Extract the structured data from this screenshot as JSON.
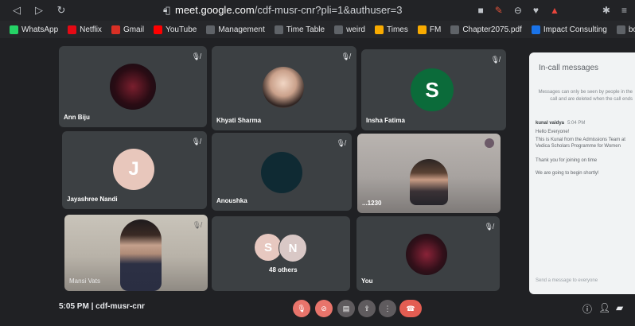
{
  "browser": {
    "url_domain": "meet.google.com",
    "url_path": "/cdf-musr-cnr?pli=1&authuser=3",
    "bookmarks": [
      {
        "label": "WhatsApp",
        "icon": "whatsapp-icon",
        "color": "#25d366"
      },
      {
        "label": "Netflix",
        "icon": "netflix-icon",
        "color": "#e50914"
      },
      {
        "label": "Gmail",
        "icon": "gmail-icon",
        "color": "#d93025"
      },
      {
        "label": "YouTube",
        "icon": "youtube-icon",
        "color": "#ff0000"
      },
      {
        "label": "Management",
        "icon": "globe-icon",
        "color": "#5f6368"
      },
      {
        "label": "Time Table",
        "icon": "globe-icon",
        "color": "#5f6368"
      },
      {
        "label": "weird",
        "icon": "globe-icon",
        "color": "#5f6368"
      },
      {
        "label": "Times",
        "icon": "folder-icon",
        "color": "#f9ab00"
      },
      {
        "label": "FM",
        "icon": "folder-icon",
        "color": "#f9ab00"
      },
      {
        "label": "Chapter2075.pdf",
        "icon": "globe-icon",
        "color": "#5f6368"
      },
      {
        "label": "Impact Consulting",
        "icon": "globe-icon",
        "color": "#1a73e8"
      },
      {
        "label": "books",
        "icon": "book-icon",
        "color": "#5f6368"
      }
    ]
  },
  "participants": [
    {
      "name": "Ann Biju",
      "type": "audio-visualizer"
    },
    {
      "name": "Khyati Sharma",
      "type": "photo"
    },
    {
      "name": "Insha Fatima",
      "type": "initial",
      "initial": "S",
      "color": "#0b6b3a"
    },
    {
      "name": "Jayashree Nandi",
      "type": "initial",
      "initial": "J",
      "color": "#e8c7bc"
    },
    {
      "name": "Anoushka",
      "type": "photo-dark"
    },
    {
      "name": "...1230",
      "type": "video"
    },
    {
      "name": "Mansi Vats",
      "type": "video"
    },
    {
      "name": "48 others",
      "type": "group",
      "initials": [
        "S",
        "N"
      ]
    },
    {
      "name": "You",
      "type": "audio-visualizer"
    }
  ],
  "chat": {
    "title": "In-call messages",
    "note": "Messages can only be seen by people in the call and are deleted when the call ends",
    "sender": "kunal vaidya",
    "time": "5:04 PM",
    "messages": [
      "Hello Everyone!",
      "This is Kunal from the Admissions Team at Vedica Scholars Programme for Women",
      "Thank you for joining on time",
      "We are going to begin shortly!"
    ],
    "input_placeholder": "Send a message to everyone"
  },
  "meeting": {
    "time": "5:05 PM",
    "code": "cdf-musr-cnr"
  }
}
